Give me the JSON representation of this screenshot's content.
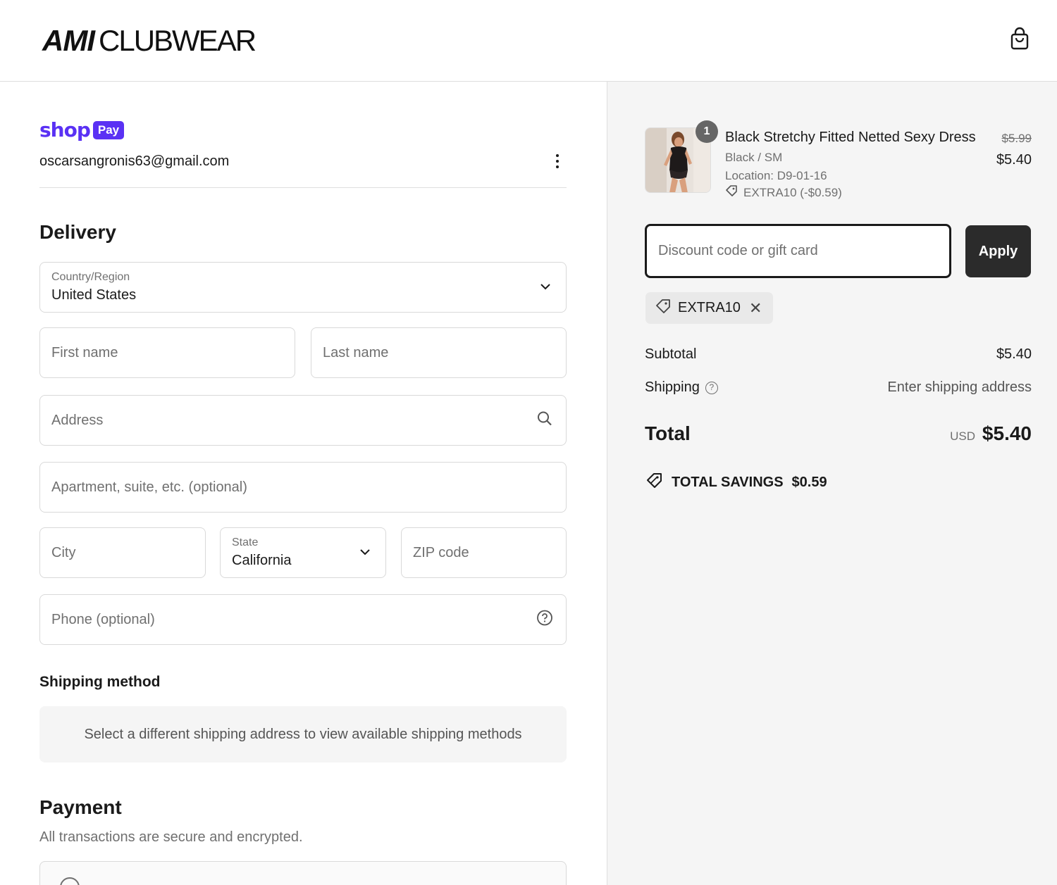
{
  "header": {
    "logo_bold": "AMI",
    "logo_light": "CLUBWEAR"
  },
  "account": {
    "shop_word": "shop",
    "shop_pill": "Pay",
    "email": "oscarsangronis63@gmail.com"
  },
  "delivery": {
    "title": "Delivery",
    "country_label": "Country/Region",
    "country_value": "United States",
    "first_name_placeholder": "First name",
    "last_name_placeholder": "Last name",
    "address_placeholder": "Address",
    "apartment_placeholder": "Apartment, suite, etc. (optional)",
    "city_placeholder": "City",
    "state_label": "State",
    "state_value": "California",
    "zip_placeholder": "ZIP code",
    "phone_placeholder": "Phone (optional)"
  },
  "shipping_method": {
    "title": "Shipping method",
    "message": "Select a different shipping address to view available shipping methods"
  },
  "payment": {
    "title": "Payment",
    "subtitle": "All transactions are secure and encrypted."
  },
  "order": {
    "quantity": "1",
    "product_title": "Black Stretchy Fitted Netted Sexy Dress",
    "variant": "Black / SM",
    "location": "Location: D9-01-16",
    "line_discount": "EXTRA10 (-$0.59)",
    "price_original": "$5.99",
    "price_final": "$5.40"
  },
  "discount": {
    "placeholder": "Discount code or gift card",
    "apply_label": "Apply",
    "applied_code": "EXTRA10"
  },
  "summary": {
    "subtotal_label": "Subtotal",
    "subtotal_value": "$5.40",
    "shipping_label": "Shipping",
    "shipping_value": "Enter shipping address",
    "total_label": "Total",
    "currency": "USD",
    "total_value": "$5.40",
    "savings_label": "TOTAL SAVINGS",
    "savings_value": "$0.59"
  },
  "colors": {
    "shop_pay_purple": "#5a31f4",
    "apply_button": "#2b2b2b",
    "summary_bg": "#f5f5f5"
  }
}
